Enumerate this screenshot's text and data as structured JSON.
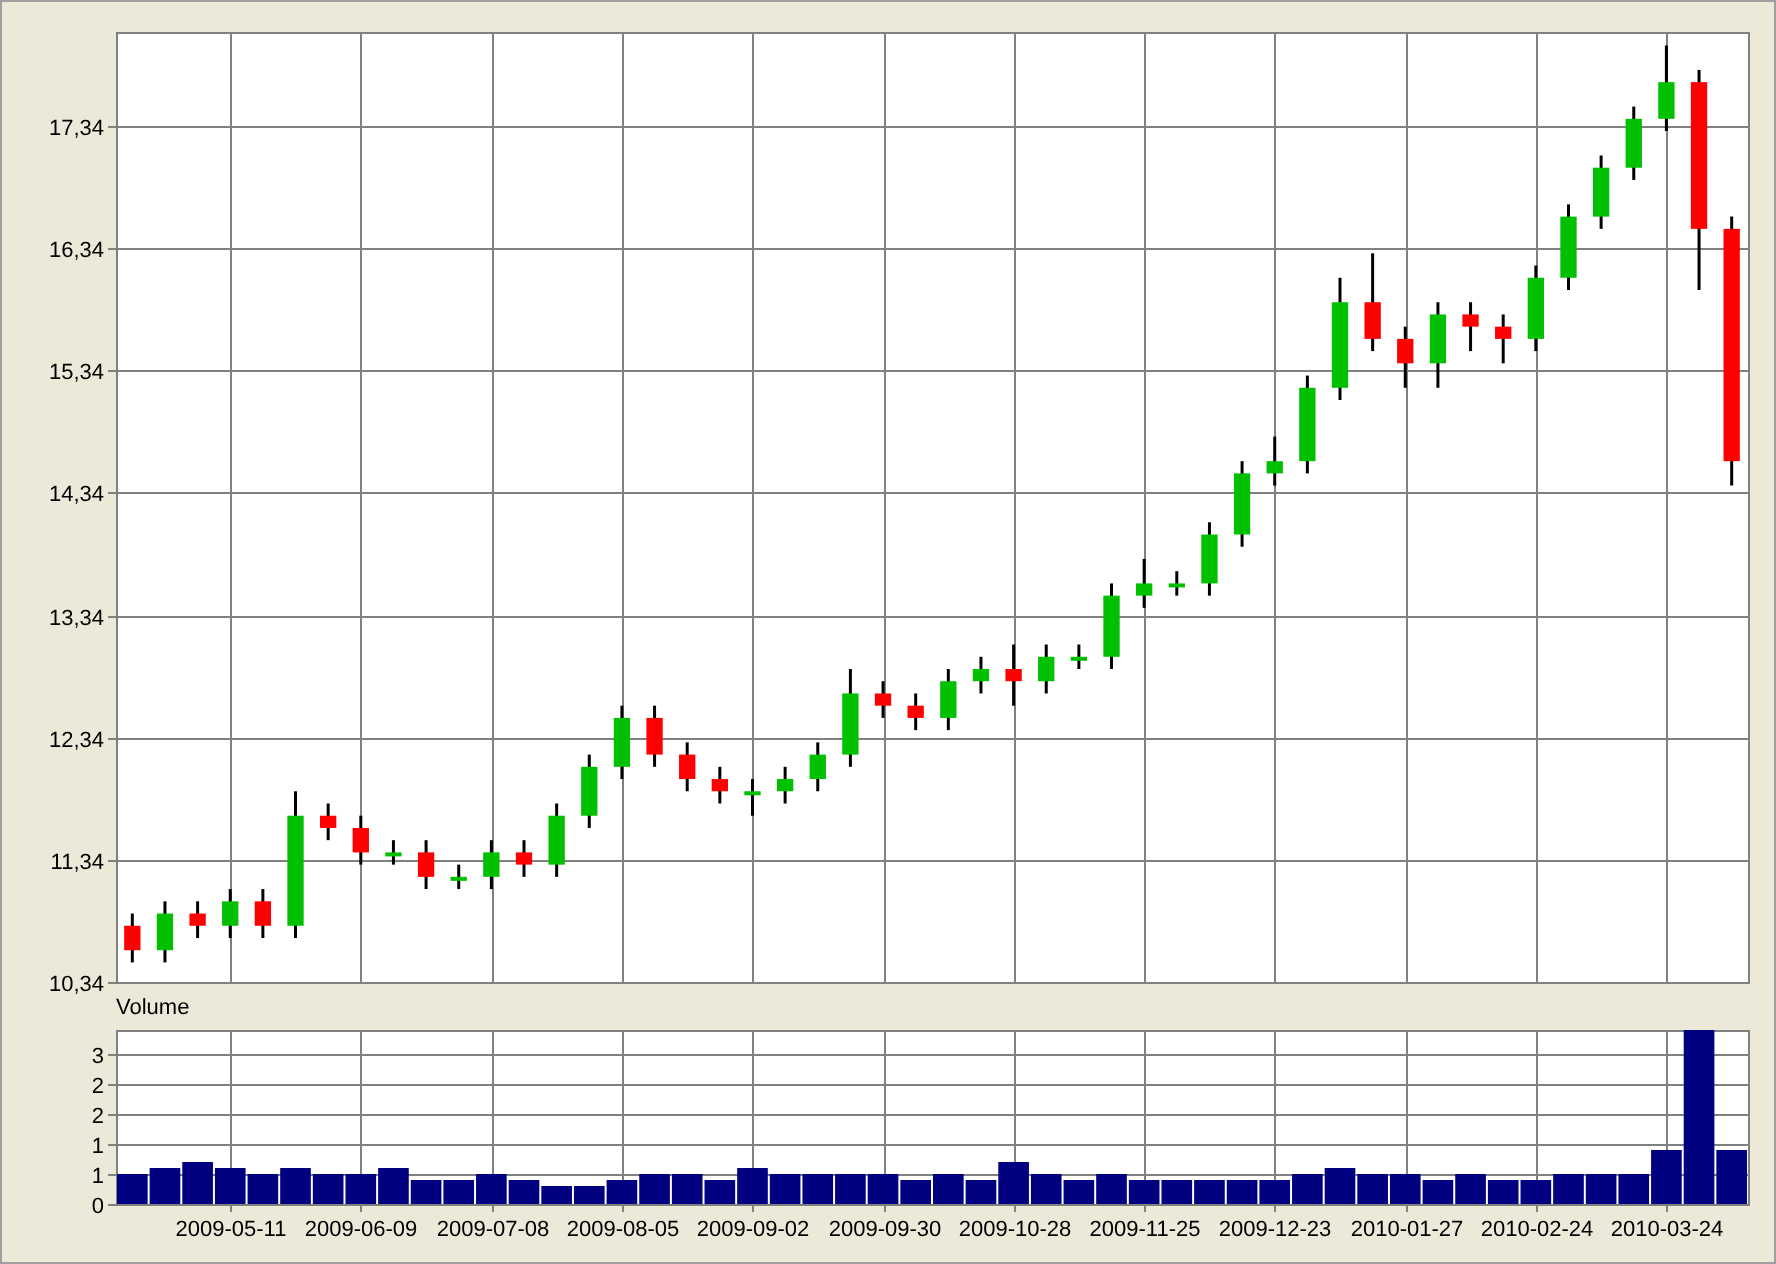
{
  "price_chart": {
    "chart_data": {
      "type": "candlestick",
      "grid": true,
      "ylim": [
        10.34,
        18.11
      ],
      "yticks": [
        {
          "value": 10.34,
          "label": "10,34"
        },
        {
          "value": 11.34,
          "label": "11,34"
        },
        {
          "value": 12.34,
          "label": "12,34"
        },
        {
          "value": 13.34,
          "label": "13,34"
        },
        {
          "value": 14.34,
          "label": "14,34"
        },
        {
          "value": 15.34,
          "label": "15,34"
        },
        {
          "value": 16.34,
          "label": "16,34"
        },
        {
          "value": 17.34,
          "label": "17,34"
        }
      ],
      "categories": [
        null,
        null,
        null,
        null,
        null,
        null,
        null,
        null,
        null,
        null,
        null,
        null,
        null,
        null,
        null,
        null,
        null,
        null,
        null,
        null,
        null,
        null,
        null,
        null,
        null,
        null,
        null,
        null,
        null,
        null,
        null,
        null,
        null,
        null,
        null,
        null,
        null,
        null,
        null,
        null,
        null,
        null,
        null,
        null,
        null,
        null,
        null,
        null,
        null,
        null
      ],
      "ohlc": [
        [
          10.8,
          10.9,
          10.5,
          10.6
        ],
        [
          10.6,
          11.0,
          10.5,
          10.9
        ],
        [
          10.9,
          11.0,
          10.7,
          10.8
        ],
        [
          10.8,
          11.1,
          10.7,
          11.0
        ],
        [
          11.0,
          11.1,
          10.7,
          10.8
        ],
        [
          10.8,
          11.9,
          10.7,
          11.7
        ],
        [
          11.7,
          11.8,
          11.5,
          11.6
        ],
        [
          11.6,
          11.7,
          11.3,
          11.4
        ],
        [
          11.4,
          11.5,
          11.3,
          11.4
        ],
        [
          11.4,
          11.5,
          11.1,
          11.2
        ],
        [
          11.2,
          11.3,
          11.1,
          11.2
        ],
        [
          11.2,
          11.5,
          11.1,
          11.4
        ],
        [
          11.4,
          11.5,
          11.2,
          11.3
        ],
        [
          11.3,
          11.8,
          11.2,
          11.7
        ],
        [
          11.7,
          12.2,
          11.6,
          12.1
        ],
        [
          12.1,
          12.6,
          12.0,
          12.5
        ],
        [
          12.5,
          12.6,
          12.1,
          12.2
        ],
        [
          12.2,
          12.3,
          11.9,
          12.0
        ],
        [
          12.0,
          12.1,
          11.8,
          11.9
        ],
        [
          11.9,
          12.0,
          11.7,
          11.9
        ],
        [
          11.9,
          12.1,
          11.8,
          12.0
        ],
        [
          12.0,
          12.3,
          11.9,
          12.2
        ],
        [
          12.2,
          12.9,
          12.1,
          12.7
        ],
        [
          12.7,
          12.8,
          12.5,
          12.6
        ],
        [
          12.6,
          12.7,
          12.4,
          12.5
        ],
        [
          12.5,
          12.9,
          12.4,
          12.8
        ],
        [
          12.8,
          13.0,
          12.7,
          12.9
        ],
        [
          12.9,
          13.1,
          12.6,
          12.8
        ],
        [
          12.8,
          13.1,
          12.7,
          13.0
        ],
        [
          13.0,
          13.1,
          12.9,
          13.0
        ],
        [
          13.0,
          13.6,
          12.9,
          13.5
        ],
        [
          13.5,
          13.8,
          13.4,
          13.6
        ],
        [
          13.6,
          13.7,
          13.5,
          13.6
        ],
        [
          13.6,
          14.1,
          13.5,
          14.0
        ],
        [
          14.0,
          14.6,
          13.9,
          14.5
        ],
        [
          14.5,
          14.8,
          14.4,
          14.6
        ],
        [
          14.6,
          15.3,
          14.5,
          15.2
        ],
        [
          15.2,
          16.1,
          15.1,
          15.9
        ],
        [
          15.9,
          16.3,
          15.5,
          15.6
        ],
        [
          15.6,
          15.7,
          15.2,
          15.4
        ],
        [
          15.4,
          15.9,
          15.2,
          15.8
        ],
        [
          15.8,
          15.9,
          15.5,
          15.7
        ],
        [
          15.7,
          15.8,
          15.4,
          15.6
        ],
        [
          15.6,
          16.2,
          15.5,
          16.1
        ],
        [
          16.1,
          16.7,
          16.0,
          16.6
        ],
        [
          16.6,
          17.1,
          16.5,
          17.0
        ],
        [
          17.0,
          17.5,
          16.9,
          17.4
        ],
        [
          17.4,
          18.0,
          17.3,
          17.7
        ],
        [
          17.7,
          17.8,
          16.0,
          16.5
        ],
        [
          16.5,
          16.6,
          14.4,
          14.6
        ]
      ]
    }
  },
  "volume_chart": {
    "chart_data": {
      "type": "bar",
      "grid": true,
      "ylim": [
        0,
        2.9
      ],
      "yticks": [
        {
          "value": 0,
          "label": "0"
        },
        {
          "value": 0.5,
          "label": "1"
        },
        {
          "value": 1,
          "label": "1"
        },
        {
          "value": 1.5,
          "label": "2"
        },
        {
          "value": 2,
          "label": "2"
        },
        {
          "value": 2.5,
          "label": "3"
        }
      ],
      "categories": [
        null,
        null,
        null,
        "2009-05-11",
        null,
        null,
        null,
        "2009-06-09",
        null,
        null,
        null,
        "2009-07-08",
        null,
        null,
        null,
        "2009-08-05",
        null,
        null,
        null,
        "2009-09-02",
        null,
        null,
        null,
        "2009-09-30",
        null,
        null,
        null,
        "2009-10-28",
        null,
        null,
        null,
        "2009-11-25",
        null,
        null,
        null,
        "2009-12-23",
        null,
        null,
        null,
        "2010-01-27",
        null,
        null,
        null,
        "2010-02-24",
        null,
        null,
        null,
        "2010-03-24",
        null,
        null
      ],
      "series": [
        {
          "name": "Volume",
          "color": "#000080",
          "values": [
            0.5,
            0.6,
            0.7,
            0.6,
            0.5,
            0.6,
            0.5,
            0.5,
            0.6,
            0.4,
            0.4,
            0.5,
            0.4,
            0.3,
            0.3,
            0.4,
            0.5,
            0.5,
            0.4,
            0.6,
            0.5,
            0.5,
            0.5,
            0.5,
            0.4,
            0.5,
            0.4,
            0.7,
            0.5,
            0.4,
            0.5,
            0.4,
            0.4,
            0.4,
            0.4,
            0.4,
            0.5,
            0.6,
            0.5,
            0.5,
            0.4,
            0.5,
            0.4,
            0.4,
            0.5,
            0.5,
            0.5,
            0.9,
            2.9,
            0.9
          ]
        }
      ]
    }
  }
}
